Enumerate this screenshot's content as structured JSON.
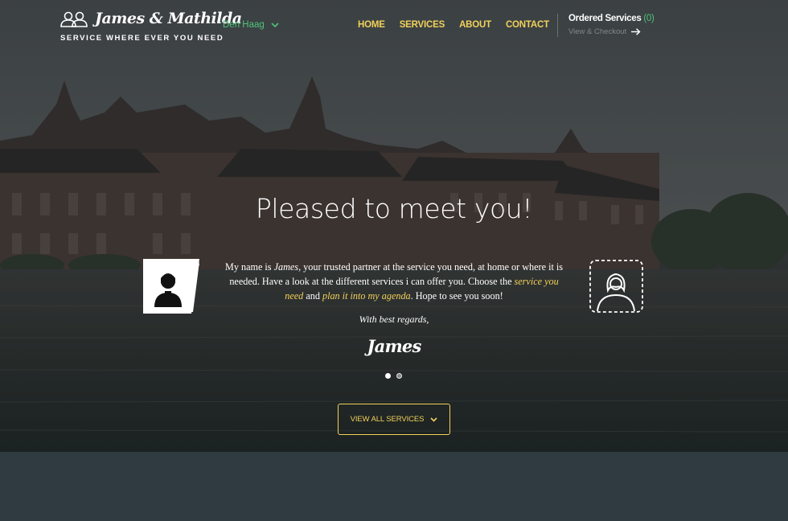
{
  "header": {
    "brand": "James & Mathilda",
    "tagline": "SERVICE WHERE EVER YOU NEED",
    "city": "Den Haag",
    "nav": [
      "HOME",
      "SERVICES",
      "ABOUT",
      "CONTACT"
    ],
    "cart_title": "Ordered Services",
    "cart_count": "(0)",
    "cart_link": "View & Checkout"
  },
  "hero": {
    "headline": "Pleased to meet you!",
    "intro_1": "My name is ",
    "intro_name": "James",
    "intro_2": ", your trusted partner at the service you need, at home or where it is needed. Have a look at the different services i can offer you. Choose the ",
    "intro_link1": "service you need",
    "intro_3": " and ",
    "intro_link2": "plan it into my agenda",
    "intro_4": ". Hope to see you soon!",
    "regards": "With best regards,",
    "signature": "James",
    "slides": 2,
    "active_slide": 1,
    "cta": "VIEW ALL SERVICES"
  },
  "icons": [
    "couple-logo-icon",
    "chevron-down-icon",
    "arrow-right-icon",
    "male-avatar-icon",
    "female-avatar-icon",
    "chevron-down-icon"
  ],
  "colors": {
    "accent": "#f2d15a",
    "green": "#4fc27a",
    "footer": "#2f3a41"
  }
}
